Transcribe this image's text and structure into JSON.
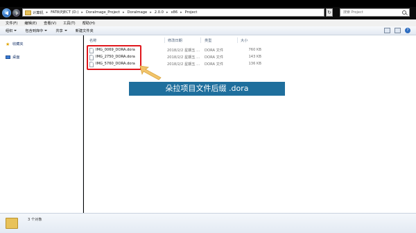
{
  "address_bar": {
    "crumbs": [
      "计算机",
      "FAT8(PJECT (D:)",
      "DoraImage_Project",
      "DoraImage",
      "2.0.0",
      "x86",
      "Project"
    ],
    "search_placeholder": "搜索 Project"
  },
  "menu": [
    "文件(F)",
    "编辑(E)",
    "查看(V)",
    "工具(T)",
    "帮助(H)"
  ],
  "toolbar": {
    "organize": "组织",
    "include": "包含到库中",
    "share": "共享",
    "new_folder": "新建文件夹"
  },
  "nav": {
    "favorites": "收藏夹",
    "desktop": "桌面"
  },
  "columns": {
    "name": "名称",
    "date": "修改日期",
    "type": "类型",
    "size": "大小"
  },
  "files": [
    {
      "name": "IMG_0069_DORA.dora",
      "date": "2018/2/2 星期五 ...",
      "type": "DORA 文件",
      "size": "760 KB"
    },
    {
      "name": "IMG_2750_DORA.dora",
      "date": "2018/2/2 星期五 ...",
      "type": "DORA 文件",
      "size": "143 KB"
    },
    {
      "name": "IMG_5760_DORA.dora",
      "date": "2018/2/2 星期五 ...",
      "type": "DORA 文件",
      "size": "136 KB"
    }
  ],
  "callout": "朵拉项目文件后缀 .dora",
  "status": "3 个对象",
  "colors": {
    "highlight": "#e0161c",
    "callout_bg": "#1f6f9d",
    "arrow": "#f2c46a"
  }
}
